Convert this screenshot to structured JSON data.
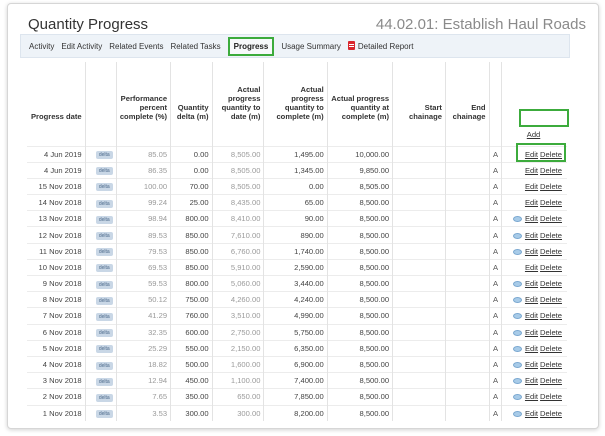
{
  "header": {
    "title": "Quantity Progress",
    "activity_ref": "44.02.01: Establish Haul Roads"
  },
  "tabs": [
    {
      "label": "Activity",
      "active": false
    },
    {
      "label": "Edit Activity",
      "active": false
    },
    {
      "label": "Related Events",
      "active": false
    },
    {
      "label": "Related Tasks",
      "active": false
    },
    {
      "label": "Progress",
      "active": true
    },
    {
      "label": "Usage Summary",
      "active": false
    },
    {
      "label": "Detailed Report",
      "active": false,
      "icon": "pdf-icon"
    }
  ],
  "columns": [
    "Progress date",
    "",
    "Performance percent complete (%)",
    "Quantity delta (m)",
    "Actual progress quantity to date (m)",
    "Actual progress quantity to complete (m)",
    "Actual progress quantity at complete (m)",
    "Start chainage",
    "End chainage",
    "",
    ""
  ],
  "add_label": "Add",
  "badge_label": "delta",
  "edit_label": "Edit",
  "delete_label": "Delete",
  "colors": {
    "highlight": "#3cab3c",
    "tabbar_bg": "#eef3f8",
    "badge_bg": "#c9d7e6",
    "pdf_icon": "#d9262d"
  },
  "rows": [
    {
      "date": "4 Jun 2019",
      "perf": "85.05",
      "delta": "0.00",
      "to_date": "8,505.00",
      "to_complete": "1,495.00",
      "at_complete": "10,000.00",
      "flag": "A",
      "comment": false
    },
    {
      "date": "4 Jun 2019",
      "perf": "86.35",
      "delta": "0.00",
      "to_date": "8,505.00",
      "to_complete": "1,345.00",
      "at_complete": "9,850.00",
      "flag": "A",
      "comment": false
    },
    {
      "date": "15 Nov 2018",
      "perf": "100.00",
      "delta": "70.00",
      "to_date": "8,505.00",
      "to_complete": "0.00",
      "at_complete": "8,505.00",
      "flag": "A",
      "comment": false
    },
    {
      "date": "14 Nov 2018",
      "perf": "99.24",
      "delta": "25.00",
      "to_date": "8,435.00",
      "to_complete": "65.00",
      "at_complete": "8,500.00",
      "flag": "A",
      "comment": false
    },
    {
      "date": "13 Nov 2018",
      "perf": "98.94",
      "delta": "800.00",
      "to_date": "8,410.00",
      "to_complete": "90.00",
      "at_complete": "8,500.00",
      "flag": "A",
      "comment": true
    },
    {
      "date": "12 Nov 2018",
      "perf": "89.53",
      "delta": "850.00",
      "to_date": "7,610.00",
      "to_complete": "890.00",
      "at_complete": "8,500.00",
      "flag": "A",
      "comment": true
    },
    {
      "date": "11 Nov 2018",
      "perf": "79.53",
      "delta": "850.00",
      "to_date": "6,760.00",
      "to_complete": "1,740.00",
      "at_complete": "8,500.00",
      "flag": "A",
      "comment": true
    },
    {
      "date": "10 Nov 2018",
      "perf": "69.53",
      "delta": "850.00",
      "to_date": "5,910.00",
      "to_complete": "2,590.00",
      "at_complete": "8,500.00",
      "flag": "A",
      "comment": false
    },
    {
      "date": "9 Nov 2018",
      "perf": "59.53",
      "delta": "800.00",
      "to_date": "5,060.00",
      "to_complete": "3,440.00",
      "at_complete": "8,500.00",
      "flag": "A",
      "comment": true
    },
    {
      "date": "8 Nov 2018",
      "perf": "50.12",
      "delta": "750.00",
      "to_date": "4,260.00",
      "to_complete": "4,240.00",
      "at_complete": "8,500.00",
      "flag": "A",
      "comment": true
    },
    {
      "date": "7 Nov 2018",
      "perf": "41.29",
      "delta": "760.00",
      "to_date": "3,510.00",
      "to_complete": "4,990.00",
      "at_complete": "8,500.00",
      "flag": "A",
      "comment": true
    },
    {
      "date": "6 Nov 2018",
      "perf": "32.35",
      "delta": "600.00",
      "to_date": "2,750.00",
      "to_complete": "5,750.00",
      "at_complete": "8,500.00",
      "flag": "A",
      "comment": true
    },
    {
      "date": "5 Nov 2018",
      "perf": "25.29",
      "delta": "550.00",
      "to_date": "2,150.00",
      "to_complete": "6,350.00",
      "at_complete": "8,500.00",
      "flag": "A",
      "comment": true
    },
    {
      "date": "4 Nov 2018",
      "perf": "18.82",
      "delta": "500.00",
      "to_date": "1,600.00",
      "to_complete": "6,900.00",
      "at_complete": "8,500.00",
      "flag": "A",
      "comment": true
    },
    {
      "date": "3 Nov 2018",
      "perf": "12.94",
      "delta": "450.00",
      "to_date": "1,100.00",
      "to_complete": "7,400.00",
      "at_complete": "8,500.00",
      "flag": "A",
      "comment": true
    },
    {
      "date": "2 Nov 2018",
      "perf": "7.65",
      "delta": "350.00",
      "to_date": "650.00",
      "to_complete": "7,850.00",
      "at_complete": "8,500.00",
      "flag": "A",
      "comment": true
    },
    {
      "date": "1 Nov 2018",
      "perf": "3.53",
      "delta": "300.00",
      "to_date": "300.00",
      "to_complete": "8,200.00",
      "at_complete": "8,500.00",
      "flag": "A",
      "comment": true
    }
  ]
}
